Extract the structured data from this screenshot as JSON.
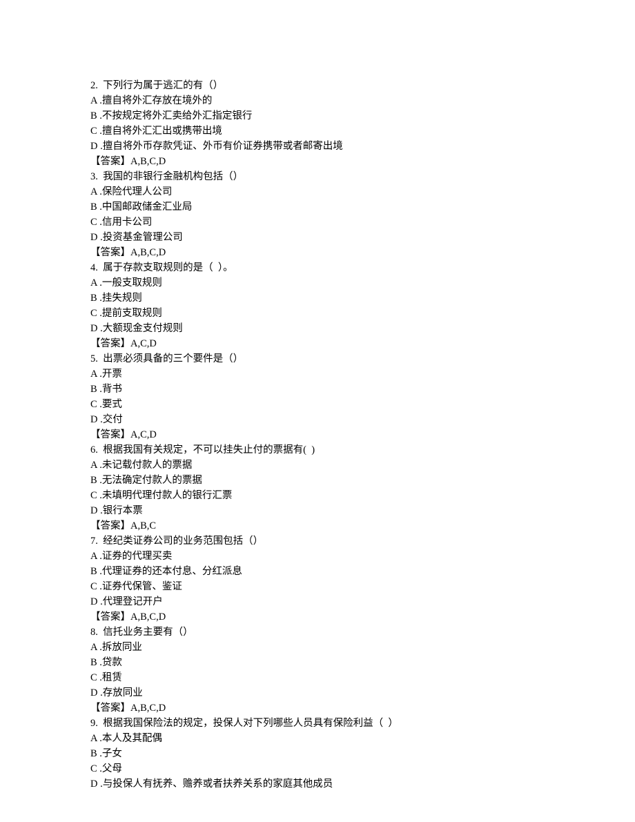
{
  "questions": [
    {
      "number": "2",
      "stem": "下列行为属于逃汇的有（）",
      "options": [
        "A .擅自将外汇存放在境外的",
        "B .不按规定将外汇卖给外汇指定银行",
        "C .擅自将外汇汇出或携带出境",
        "D .擅自将外币存款凭证、外币有价证券携带或者邮寄出境"
      ],
      "answer": "A,B,C,D"
    },
    {
      "number": "3",
      "stem": "我国的非银行金融机构包括（）",
      "options": [
        "A .保险代理人公司",
        "B .中国邮政储金汇业局",
        "C .信用卡公司",
        "D .投资基金管理公司"
      ],
      "answer": "A,B,C,D"
    },
    {
      "number": "4",
      "stem": "属于存款支取规则的是（  ）。",
      "options": [
        "A .一般支取规则",
        "B .挂失规则",
        "C .提前支取规则",
        "D .大额现金支付规则"
      ],
      "answer": "A,C,D"
    },
    {
      "number": "5",
      "stem": "出票必须具备的三个要件是（）",
      "options": [
        "A .开票",
        "B .背书",
        "C .要式",
        "D .交付"
      ],
      "answer": "A,C,D"
    },
    {
      "number": "6",
      "stem": "根据我国有关规定，不可以挂失止付的票据有(  )",
      "options": [
        "A .未记载付款人的票据",
        "B .无法确定付款人的票据",
        "C .未填明代理付款人的银行汇票",
        "D .银行本票"
      ],
      "answer": "A,B,C"
    },
    {
      "number": "7",
      "stem": "经纪类证券公司的业务范围包括（）",
      "options": [
        "A .证券的代理买卖",
        "B .代理证券的还本付息、分红派息",
        "C .证券代保管、鉴证",
        "D .代理登记开户"
      ],
      "answer": "A,B,C,D"
    },
    {
      "number": "8",
      "stem": "信托业务主要有（）",
      "options": [
        "A .拆放同业",
        "B .贷款",
        "C .租赁",
        "D .存放同业"
      ],
      "answer": "A,B,C,D"
    },
    {
      "number": "9",
      "stem": "根据我国保险法的规定，投保人对下列哪些人员具有保险利益（  ）",
      "options": [
        "A .本人及其配偶",
        "B .子女",
        "C .父母",
        "D .与投保人有抚养、赡养或者扶养关系的家庭其他成员"
      ],
      "answer": null
    }
  ],
  "answer_label": "【答案】"
}
